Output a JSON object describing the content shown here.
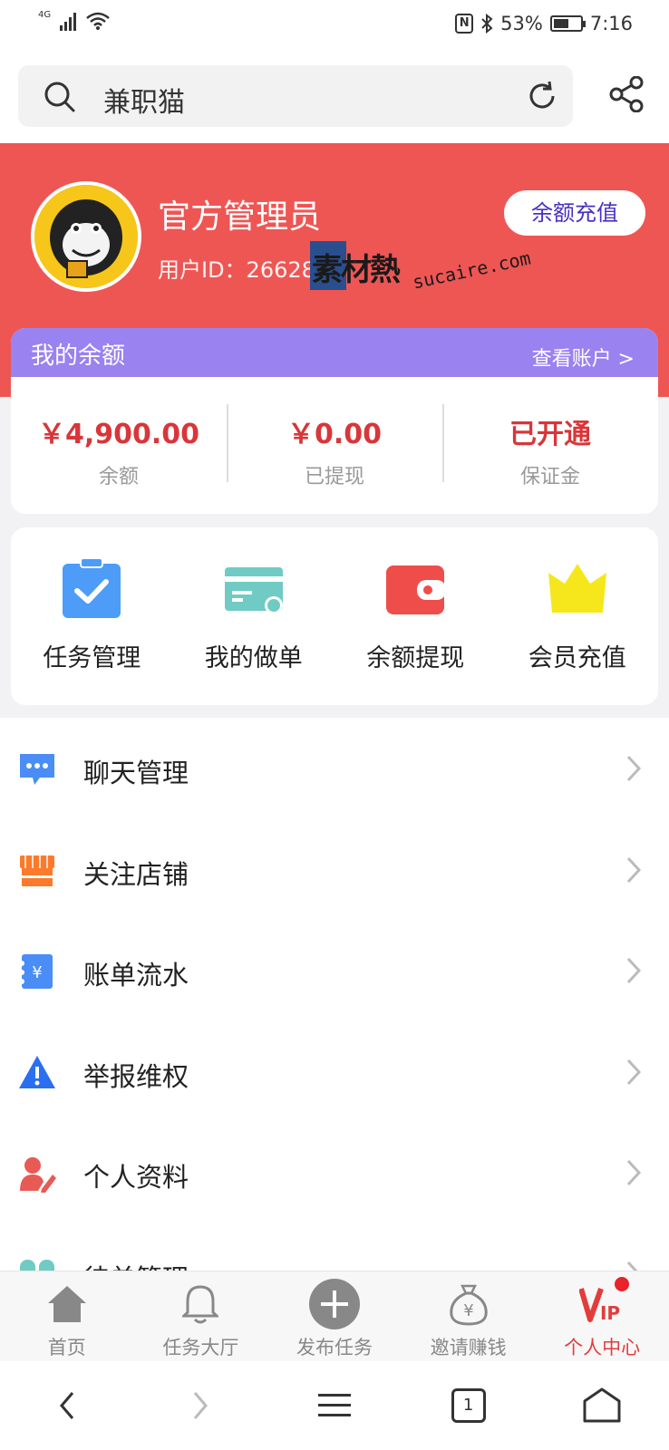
{
  "status_bar": {
    "network": "4G",
    "battery": "53%",
    "time": "7:16"
  },
  "search": {
    "query": "兼职猫"
  },
  "profile": {
    "name": "官方管理员",
    "user_id": "用户ID：26628",
    "recharge_button": "余额充值",
    "watermark": "素材熱",
    "watermark_url": "sucaire.com"
  },
  "balance": {
    "title": "我的余额",
    "link": "查看账户 >",
    "items": [
      {
        "value": "￥4,900.00",
        "label": "余额"
      },
      {
        "value": "￥0.00",
        "label": "已提现"
      },
      {
        "value": "已开通",
        "label": "保证金"
      }
    ]
  },
  "quick_actions": [
    {
      "label": "任务管理",
      "icon": "task-icon"
    },
    {
      "label": "我的做单",
      "icon": "card-icon"
    },
    {
      "label": "余额提现",
      "icon": "wallet-icon"
    },
    {
      "label": "会员充值",
      "icon": "crown-icon"
    }
  ],
  "menu": [
    {
      "label": "聊天管理",
      "icon": "chat-icon"
    },
    {
      "label": "关注店铺",
      "icon": "store-icon"
    },
    {
      "label": "账单流水",
      "icon": "bill-icon"
    },
    {
      "label": "举报维权",
      "icon": "warning-icon"
    },
    {
      "label": "个人资料",
      "icon": "profile-icon"
    },
    {
      "label": "待单管理",
      "icon": "orders-icon"
    }
  ],
  "tabs": [
    {
      "label": "首页",
      "icon": "home-icon"
    },
    {
      "label": "任务大厅",
      "icon": "bell-icon"
    },
    {
      "label": "发布任务",
      "icon": "plus-icon"
    },
    {
      "label": "邀请赚钱",
      "icon": "money-bag-icon"
    },
    {
      "label": "个人中心",
      "icon": "vip-icon"
    }
  ],
  "system_nav": {
    "tab_count": "1"
  },
  "colors": {
    "header_red": "#ee5654",
    "balance_purple": "#9a82f0",
    "value_red": "#d8363a",
    "active_tab": "#e33c3c"
  }
}
